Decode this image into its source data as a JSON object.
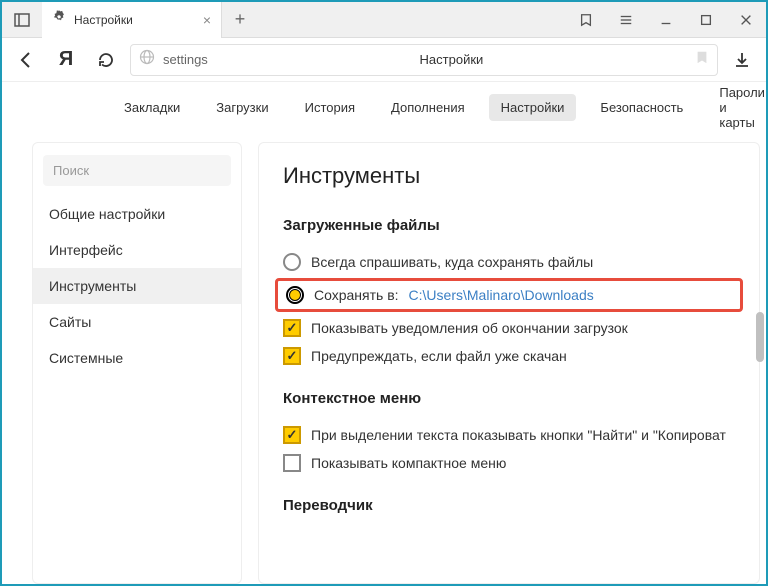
{
  "tab": {
    "title": "Настройки"
  },
  "address": {
    "text": "settings",
    "pageTitle": "Настройки"
  },
  "navTabs": [
    "Закладки",
    "Загрузки",
    "История",
    "Дополнения",
    "Настройки",
    "Безопасность",
    "Пароли и карты"
  ],
  "navActiveIndex": 4,
  "sidebar": {
    "searchPlaceholder": "Поиск",
    "items": [
      "Общие настройки",
      "Интерфейс",
      "Инструменты",
      "Сайты",
      "Системные"
    ],
    "activeIndex": 2
  },
  "main": {
    "heading": "Инструменты",
    "sections": {
      "downloads": {
        "title": "Загруженные файлы",
        "alwaysAsk": "Всегда спрашивать, куда сохранять файлы",
        "saveToLabel": "Сохранять в:",
        "saveToPath": "C:\\Users\\Malinaro\\Downloads",
        "showNotifications": "Показывать уведомления об окончании загрузок",
        "warnDuplicate": "Предупреждать, если файл уже скачан"
      },
      "contextMenu": {
        "title": "Контекстное меню",
        "showButtons": "При выделении текста показывать кнопки \"Найти\" и \"Копироват",
        "compactMenu": "Показывать компактное меню"
      },
      "translator": {
        "title": "Переводчик"
      }
    }
  }
}
